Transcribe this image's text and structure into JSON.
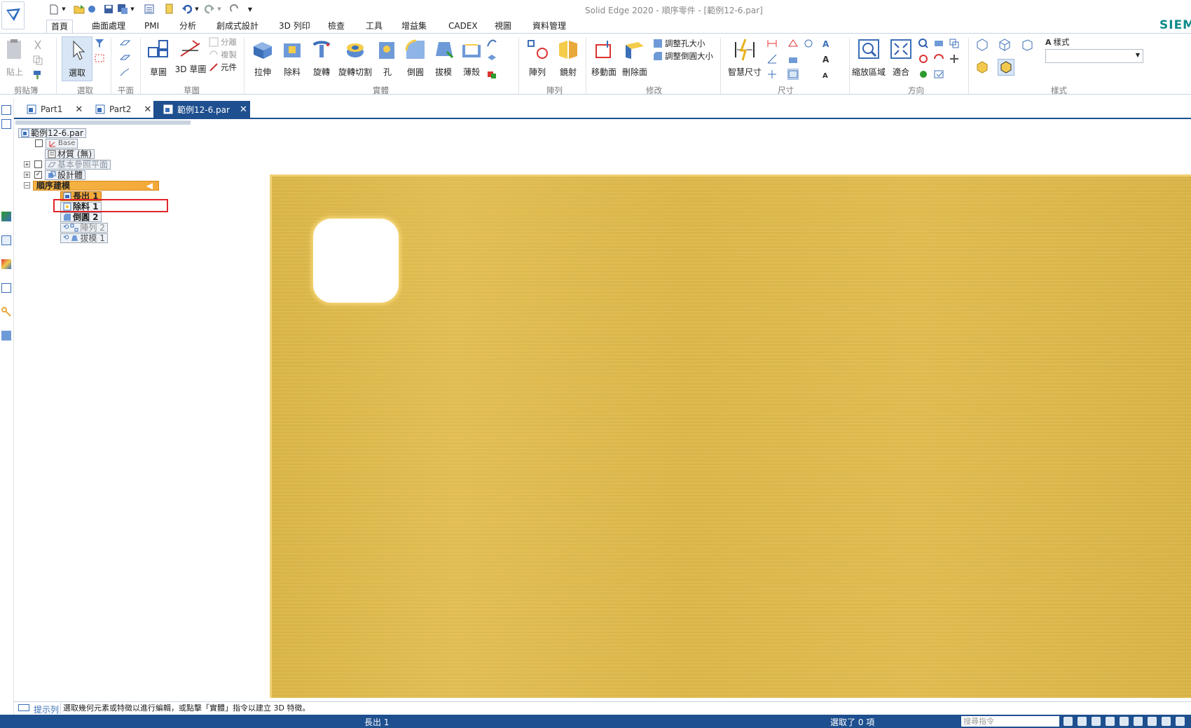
{
  "window": {
    "title": "Solid Edge 2020 - 順序零件 - [範例12-6.par]",
    "brand": "SIEMENS"
  },
  "ribbon_tabs": [
    "首頁",
    "曲面處理",
    "PMI",
    "分析",
    "創成式設計",
    "3D 列印",
    "檢查",
    "工具",
    "增益集",
    "CADEX",
    "視圖",
    "資料管理"
  ],
  "ribbon": {
    "clipboard": {
      "paste": "貼上",
      "group": "剪貼簿"
    },
    "select": {
      "select": "選取",
      "group": "選取"
    },
    "plane": {
      "group": "平面"
    },
    "sketch": {
      "sketch": "草圖",
      "sketch3d": "3D 草圖",
      "split": "分離",
      "copy": "複製",
      "component": "元件",
      "group": "草圖"
    },
    "solids": {
      "extrude": "拉伸",
      "cut": "除料",
      "revolve": "旋轉",
      "revolve_cut": "旋轉切割",
      "hole": "孔",
      "round": "倒圓",
      "draft": "拔模",
      "thinwall": "薄殼",
      "group": "實體"
    },
    "pattern": {
      "pattern": "陣列",
      "mirror": "鏡射",
      "group": "陣列"
    },
    "modify": {
      "move_face": "移動面",
      "delete_face": "刪除面",
      "resize_hole": "調整孔大小",
      "resize_round": "調整倒圓大小",
      "group": "修改"
    },
    "dimension": {
      "smart_dim": "智慧尺寸",
      "group": "尺寸"
    },
    "orient": {
      "zoom_area": "縮放區域",
      "fit": "適合",
      "group": "方向"
    },
    "style": {
      "style": "樣式",
      "group": "樣式",
      "value": ""
    }
  },
  "doc_tabs": [
    {
      "label": "Part1",
      "active": false
    },
    {
      "label": "Part2",
      "active": false
    },
    {
      "label": "範例12-6.par",
      "active": true
    }
  ],
  "tree": {
    "root": "範例12-6.par",
    "base": "Base",
    "material": "材質 (無)",
    "ref_planes": "基本參照平面",
    "design_body": "設計體",
    "ordered": "順序建模",
    "features": [
      "長出 1",
      "除料 1",
      "倒圓 2",
      "陣列 2",
      "拔模 1"
    ],
    "highlighted": "倒圓 2"
  },
  "prompt": {
    "label": "提示列",
    "text": "選取幾何元素或特徵以進行編輯，或點擊「實體」指令以建立 3D 特徵。"
  },
  "status": {
    "feature": "長出 1",
    "selection": "選取了 0 項",
    "search_placeholder": "搜尋指令"
  },
  "colors": {
    "accent": "#1e4f8f",
    "part": "#ddb84c",
    "ordered_bar": "#f3a93a",
    "highlight_box": "#e0252b"
  }
}
